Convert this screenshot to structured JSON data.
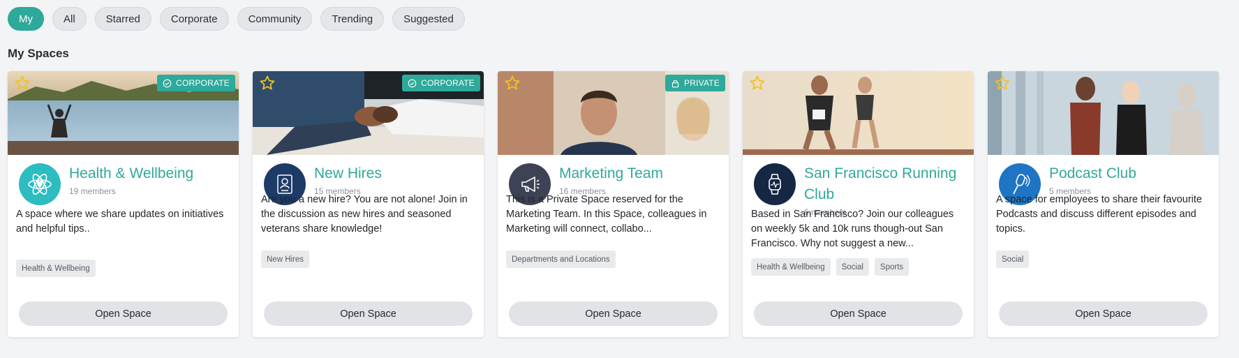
{
  "filters": {
    "my": "My",
    "all": "All",
    "starred": "Starred",
    "corporate": "Corporate",
    "community": "Community",
    "trending": "Trending",
    "suggested": "Suggested"
  },
  "section_title": "My Spaces",
  "colors": {
    "accent": "#2ea99b",
    "star": "#f2c21b"
  },
  "cards": [
    {
      "title": "Health & Wellbeing",
      "members": "19 members",
      "badge": "CORPORATE",
      "badge_icon": "check-circle-icon",
      "avatar_icon": "atom-heart-icon",
      "description": "A space where we share updates on initiatives and helpful tips..",
      "tags": [
        "Health & Wellbeing"
      ],
      "button": "Open Space"
    },
    {
      "title": "New Hires",
      "members": "15 members",
      "badge": "CORPORATE",
      "badge_icon": "check-circle-icon",
      "avatar_icon": "id-badge-icon",
      "description": "Are you a new hire? You are not alone! Join in the discussion as new hires and seasoned veterans share knowledge!",
      "tags": [
        "New Hires"
      ],
      "button": "Open Space"
    },
    {
      "title": "Marketing Team",
      "members": "16 members",
      "badge": "PRIVATE",
      "badge_icon": "lock-icon",
      "avatar_icon": "megaphone-icon",
      "description": "This is a Private Space reserved for the Marketing Team. In this Space, colleagues in Marketing will connect, collabo...",
      "tags": [
        "Departments and Locations"
      ],
      "button": "Open Space"
    },
    {
      "title": "San Francisco Running Club",
      "members": "6 members",
      "avatar_icon": "smartwatch-icon",
      "description": "Based in San Francisco? Join our colleagues on weekly 5k and 10k runs though-out San Francisco. Why not suggest a new...",
      "tags": [
        "Health & Wellbeing",
        "Social",
        "Sports"
      ],
      "button": "Open Space"
    },
    {
      "title": "Podcast Club",
      "members": "5 members",
      "avatar_icon": "microphone-icon",
      "description": "A space for employees to share their favourite Podcasts and discuss different episodes and topics.",
      "tags": [
        "Social"
      ],
      "button": "Open Space"
    }
  ]
}
